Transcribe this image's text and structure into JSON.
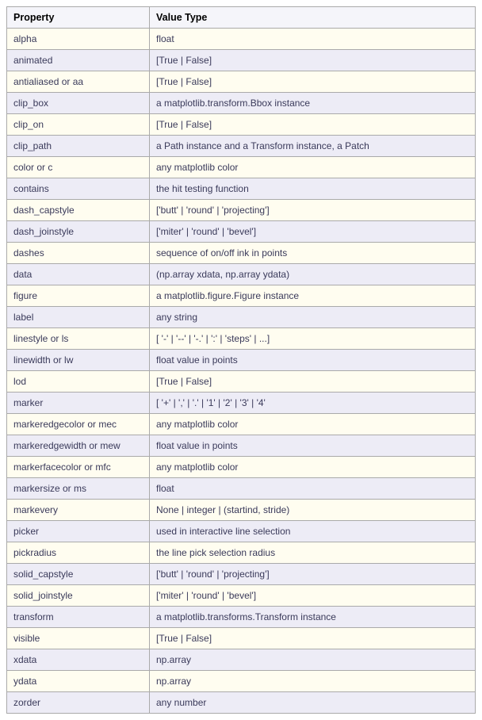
{
  "headers": {
    "property": "Property",
    "value_type": "Value Type"
  },
  "rows": [
    {
      "property": "alpha",
      "value_type": "float"
    },
    {
      "property": "animated",
      "value_type": "[True | False]"
    },
    {
      "property": "antialiased or aa",
      "value_type": "[True | False]"
    },
    {
      "property": "clip_box",
      "value_type": "a matplotlib.transform.Bbox instance"
    },
    {
      "property": "clip_on",
      "value_type": "[True | False]"
    },
    {
      "property": "clip_path",
      "value_type": "a Path instance and a Transform instance, a Patch"
    },
    {
      "property": "color or c",
      "value_type": "any matplotlib color"
    },
    {
      "property": "contains",
      "value_type": "the hit testing function"
    },
    {
      "property": "dash_capstyle",
      "value_type": "['butt' | 'round' | 'projecting']"
    },
    {
      "property": "dash_joinstyle",
      "value_type": "['miter' | 'round' | 'bevel']"
    },
    {
      "property": "dashes",
      "value_type": "sequence of on/off ink in points"
    },
    {
      "property": "data",
      "value_type": "(np.array xdata, np.array ydata)"
    },
    {
      "property": "figure",
      "value_type": "a matplotlib.figure.Figure instance"
    },
    {
      "property": "label",
      "value_type": "any string"
    },
    {
      "property": "linestyle or ls",
      "value_type": "[ '-' | '--' | '-.' | ':' | 'steps' | ...]"
    },
    {
      "property": "linewidth or lw",
      "value_type": "float value in points"
    },
    {
      "property": "lod",
      "value_type": "[True | False]"
    },
    {
      "property": "marker",
      "value_type": "[ '+' | ',' | '.' | '1' | '2' | '3' | '4'"
    },
    {
      "property": "markeredgecolor or mec",
      "value_type": "any matplotlib color"
    },
    {
      "property": "markeredgewidth or mew",
      "value_type": "float value in points"
    },
    {
      "property": "markerfacecolor or mfc",
      "value_type": "any matplotlib color"
    },
    {
      "property": "markersize or ms",
      "value_type": "float"
    },
    {
      "property": "markevery",
      "value_type": "None | integer | (startind, stride)"
    },
    {
      "property": "picker",
      "value_type": "used in interactive line selection"
    },
    {
      "property": "pickradius",
      "value_type": "the line pick selection radius"
    },
    {
      "property": "solid_capstyle",
      "value_type": "['butt' | 'round' | 'projecting']"
    },
    {
      "property": "solid_joinstyle",
      "value_type": "['miter' | 'round' | 'bevel']"
    },
    {
      "property": "transform",
      "value_type": "a matplotlib.transforms.Transform instance"
    },
    {
      "property": "visible",
      "value_type": "[True | False]"
    },
    {
      "property": "xdata",
      "value_type": "np.array"
    },
    {
      "property": "ydata",
      "value_type": "np.array"
    },
    {
      "property": "zorder",
      "value_type": "any number"
    }
  ]
}
